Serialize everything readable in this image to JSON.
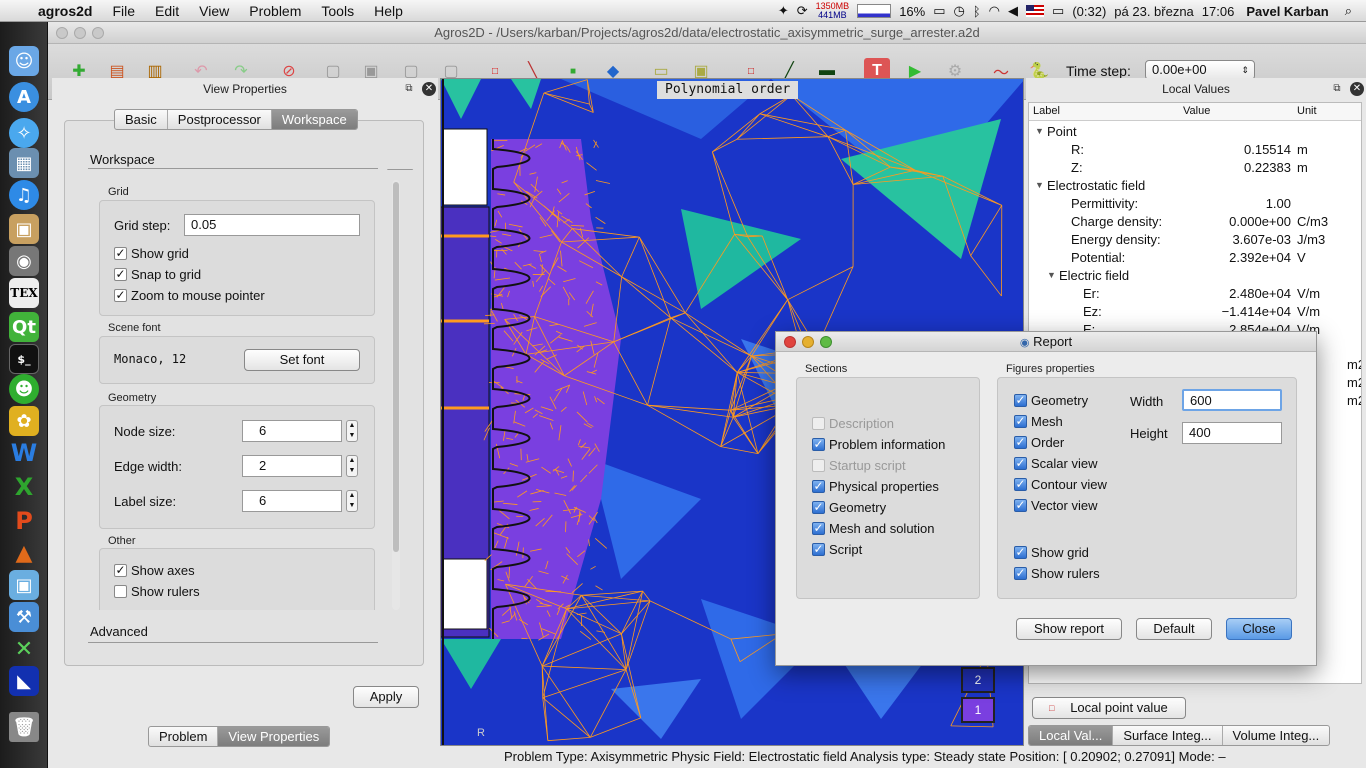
{
  "menubar": {
    "app": "agros2d",
    "items": [
      "File",
      "Edit",
      "View",
      "Problem",
      "Tools",
      "Help"
    ],
    "mem_top": "1350MB",
    "mem_bottom": "441MB",
    "cpu": "16%",
    "battery": "(0:32)",
    "date": "pá 23. března",
    "time": "17:06",
    "user": "Pavel Karban"
  },
  "window": {
    "title": "Agros2D - /Users/karban/Projects/agros2d/data/electrostatic_axisymmetric_surge_arrester.a2d"
  },
  "toolbar": {
    "time_step_label": "Time step:",
    "time_step_value": "0.00e+00"
  },
  "view_properties": {
    "header": "View Properties",
    "tabs": [
      "Basic",
      "Postprocessor",
      "Workspace"
    ],
    "section_workspace": "Workspace",
    "grid_label": "Grid",
    "grid_step_label": "Grid step:",
    "grid_step_value": "0.05",
    "show_grid": "Show grid",
    "snap_to_grid": "Snap to grid",
    "zoom_to_mouse": "Zoom to mouse pointer",
    "scene_font_label": "Scene font",
    "scene_font_value": "Monaco, 12",
    "set_font": "Set font",
    "geometry_label": "Geometry",
    "node_size_label": "Node size:",
    "node_size_value": "6",
    "edge_width_label": "Edge width:",
    "edge_width_value": "2",
    "label_size_label": "Label size:",
    "label_size_value": "6",
    "other_label": "Other",
    "show_axes": "Show axes",
    "show_rulers": "Show rulers",
    "section_advanced": "Advanced",
    "apply": "Apply",
    "bottom_tabs": [
      "Problem",
      "View Properties"
    ]
  },
  "canvas": {
    "overlay_title": "Polynomial order",
    "legend": [
      "2",
      "1"
    ],
    "axis_r": "R"
  },
  "local_values": {
    "header": "Local Values",
    "col_label": "Label",
    "col_value": "Value",
    "col_unit": "Unit",
    "rows": [
      {
        "label": "Point",
        "value": "",
        "unit": "",
        "indent": 0,
        "group": true
      },
      {
        "label": "R:",
        "value": "0.15514",
        "unit": "m",
        "indent": 2
      },
      {
        "label": "Z:",
        "value": "0.22383",
        "unit": "m",
        "indent": 2
      },
      {
        "label": "Electrostatic field",
        "value": "",
        "unit": "",
        "indent": 0,
        "group": true
      },
      {
        "label": "Permittivity:",
        "value": "1.00",
        "unit": "",
        "indent": 2
      },
      {
        "label": "Charge density:",
        "value": "0.000e+00",
        "unit": "C/m3",
        "indent": 2
      },
      {
        "label": "Energy density:",
        "value": "3.607e-03",
        "unit": "J/m3",
        "indent": 2
      },
      {
        "label": "Potential:",
        "value": "2.392e+04",
        "unit": "V",
        "indent": 2
      },
      {
        "label": "Electric field",
        "value": "",
        "unit": "",
        "indent": 1,
        "group": true
      },
      {
        "label": "Er:",
        "value": "2.480e+04",
        "unit": "V/m",
        "indent": 3
      },
      {
        "label": "Ez:",
        "value": "−1.414e+04",
        "unit": "V/m",
        "indent": 3
      },
      {
        "label": "E:",
        "value": "2.854e+04",
        "unit": "V/m",
        "indent": 3
      }
    ],
    "hidden_units": [
      "m2",
      "m2",
      "m2"
    ],
    "local_point_button": "Local point value",
    "bottom_tabs": [
      "Local Val...",
      "Surface Integ...",
      "Volume Integ..."
    ]
  },
  "report": {
    "title": "Report",
    "sections_label": "Sections",
    "sections": [
      {
        "label": "Description",
        "checked": false,
        "disabled": true
      },
      {
        "label": "Problem information",
        "checked": true,
        "disabled": false
      },
      {
        "label": "Startup script",
        "checked": false,
        "disabled": true
      },
      {
        "label": "Physical properties",
        "checked": true,
        "disabled": false
      },
      {
        "label": "Geometry",
        "checked": true,
        "disabled": false
      },
      {
        "label": "Mesh and solution",
        "checked": true,
        "disabled": false
      },
      {
        "label": "Script",
        "checked": true,
        "disabled": false
      }
    ],
    "figures_label": "Figures properties",
    "figures": [
      "Geometry",
      "Mesh",
      "Order",
      "Scalar view",
      "Contour view",
      "Vector view"
    ],
    "figures2": [
      "Show grid",
      "Show rulers"
    ],
    "width_label": "Width",
    "width_value": "600",
    "height_label": "Height",
    "height_value": "400",
    "show_report": "Show report",
    "default": "Default",
    "close": "Close"
  },
  "status": {
    "text": "Problem Type: Axisymmetric  Physic Field: Electrostatic field  Analysis type: Steady state  Position: [ 0.20902;  0.27091]  Mode: –"
  },
  "colors": {
    "accent": "#3a73c0",
    "mesh_blue": "#1a35c8",
    "mesh_orange": "#ff9a1e",
    "order_purple": "#7a3fe0",
    "order_teal": "#1fb8a0"
  }
}
